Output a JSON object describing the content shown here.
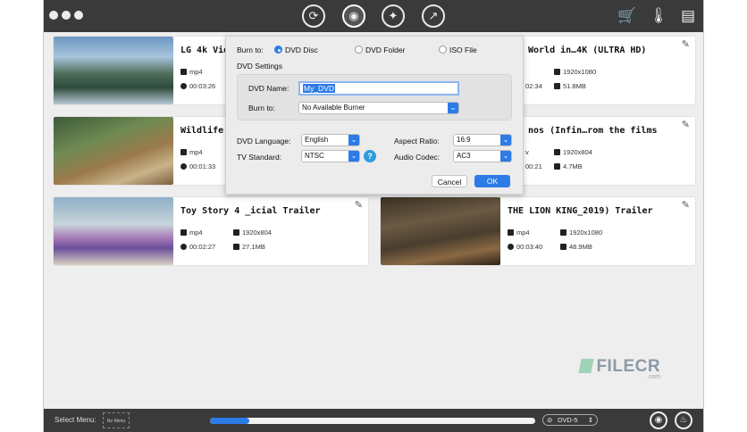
{
  "toolbar": {
    "tabs": [
      "convert-icon",
      "burn-dvd-icon",
      "toolbox-icon",
      "export-icon"
    ],
    "right_icons": [
      "cart-icon",
      "thermometer-icon",
      "folder-icon"
    ]
  },
  "cards": [
    {
      "title": "LG 4k Vid",
      "format": "mp4",
      "resolution": "",
      "duration": "00:03:26",
      "size": ""
    },
    {
      "title": "World in…4K (ULTRA HD)",
      "format": "",
      "resolution": "1920x1080",
      "duration": "02:34",
      "size": "51.8MB"
    },
    {
      "title": "Wildlife",
      "format": "mp4",
      "resolution": "",
      "duration": "00:01:33",
      "size": ""
    },
    {
      "title": "nos (Infin…rom the films",
      "format": "v",
      "resolution": "1920x804",
      "duration": "00:21",
      "size": "4.7MB"
    },
    {
      "title": "Toy Story 4 _icial Trailer",
      "format": "mp4",
      "resolution": "1920x804",
      "duration": "00:02:27",
      "size": "27.1MB"
    },
    {
      "title": "THE LION KING_2019) Trailer",
      "format": "mp4",
      "resolution": "1920x1080",
      "duration": "00:03:40",
      "size": "48.9MB"
    }
  ],
  "dialog": {
    "burn_to_label": "Burn to:",
    "options": [
      "DVD Disc",
      "DVD Folder",
      "ISO File"
    ],
    "settings_title": "DVD Settings",
    "name_label": "DVD Name:",
    "name_value": "My_DVD",
    "burner_label": "Burn to:",
    "burner_value": "No Available Burner",
    "language_label": "DVD Language:",
    "language_value": "English",
    "standard_label": "TV Standard:",
    "standard_value": "NTSC",
    "aspect_label": "Aspect Ratio:",
    "aspect_value": "16:9",
    "codec_label": "Audio Codec:",
    "codec_value": "AC3",
    "help": "?",
    "cancel": "Cancel",
    "ok": "OK"
  },
  "statusbar": {
    "select_menu_label": "Select Menu:",
    "menu_value": "No Menu",
    "disc_type": "DVD-5",
    "progress": 0.12
  },
  "watermark": {
    "brand": "FILECR",
    "domain": ".com"
  },
  "colors": {
    "accent": "#2d7be6",
    "titlebar": "#3a3a3a",
    "dialog": "#ececec"
  }
}
